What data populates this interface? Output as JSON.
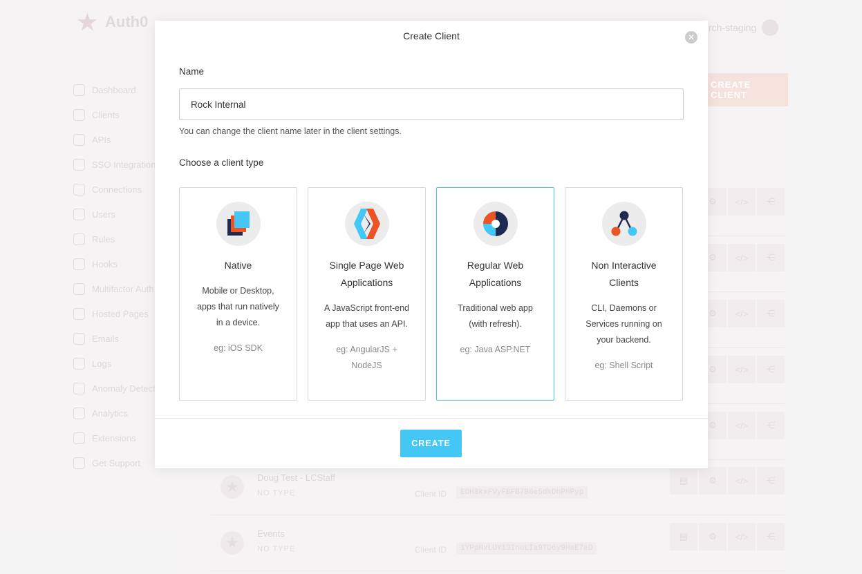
{
  "background": {
    "brand": "Auth0",
    "tenant": "rch-staging",
    "create_button": "CREATE CLIENT",
    "sidebar": [
      {
        "label": "Dashboard",
        "icon": "dashboard-icon"
      },
      {
        "label": "Clients",
        "icon": "clients-icon"
      },
      {
        "label": "APIs",
        "icon": "apis-icon"
      },
      {
        "label": "SSO Integrations",
        "icon": "sso-icon"
      },
      {
        "label": "Connections",
        "icon": "connections-icon"
      },
      {
        "label": "Users",
        "icon": "users-icon"
      },
      {
        "label": "Rules",
        "icon": "rules-icon"
      },
      {
        "label": "Hooks",
        "icon": "hooks-icon"
      },
      {
        "label": "Multifactor Auth",
        "icon": "mfa-icon"
      },
      {
        "label": "Hosted Pages",
        "icon": "hosted-pages-icon"
      },
      {
        "label": "Emails",
        "icon": "emails-icon"
      },
      {
        "label": "Logs",
        "icon": "logs-icon"
      },
      {
        "label": "Anomaly Detection",
        "icon": "anomaly-icon"
      },
      {
        "label": "Analytics",
        "icon": "analytics-icon"
      },
      {
        "label": "Extensions",
        "icon": "extensions-icon"
      },
      {
        "label": "Get Support",
        "icon": "support-icon"
      }
    ],
    "client_rows": [
      {
        "name": "Doug Test - LCStaff",
        "type": "NO TYPE",
        "client_id_label": "Client ID",
        "client_id": "EOH8kxFVyFBFB7B6e5dkDhPHPyp"
      },
      {
        "name": "Events",
        "type": "NO TYPE",
        "client_id_label": "Client ID",
        "client_id": "1YPpHxLUY13InuLIa9TD6y9HaE7eD"
      }
    ]
  },
  "modal": {
    "title": "Create Client",
    "name_label": "Name",
    "name_value": "Rock Internal",
    "name_help": "You can change the client name later in the client settings.",
    "type_label": "Choose a client type",
    "create_label": "CREATE",
    "accent_color": "#44c7f4",
    "selected_type": "Regular Web Applications",
    "client_types": [
      {
        "title_1": "Native",
        "title_2": "",
        "desc_1": "Mobile or Desktop,",
        "desc_2": "apps that run natively",
        "desc_3": "in a device.",
        "example_1": "eg: iOS SDK",
        "example_2": "",
        "icon": "native-icon"
      },
      {
        "title_1": "Single Page Web",
        "title_2": "Applications",
        "desc_1": "A JavaScript front-end",
        "desc_2": "app that uses an API.",
        "desc_3": "",
        "example_1": "eg: AngularJS +",
        "example_2": "NodeJS",
        "icon": "spa-icon"
      },
      {
        "title_1": "Regular Web",
        "title_2": "Applications",
        "desc_1": "Traditional web app",
        "desc_2": "(with refresh).",
        "desc_3": "",
        "example_1": "eg: Java ASP.NET",
        "example_2": "",
        "icon": "regular-web-icon"
      },
      {
        "title_1": "Non Interactive",
        "title_2": "Clients",
        "desc_1": "CLI, Daemons or",
        "desc_2": "Services running on",
        "desc_3": "your backend.",
        "example_1": "eg: Shell Script",
        "example_2": "",
        "icon": "non-interactive-icon"
      }
    ]
  }
}
